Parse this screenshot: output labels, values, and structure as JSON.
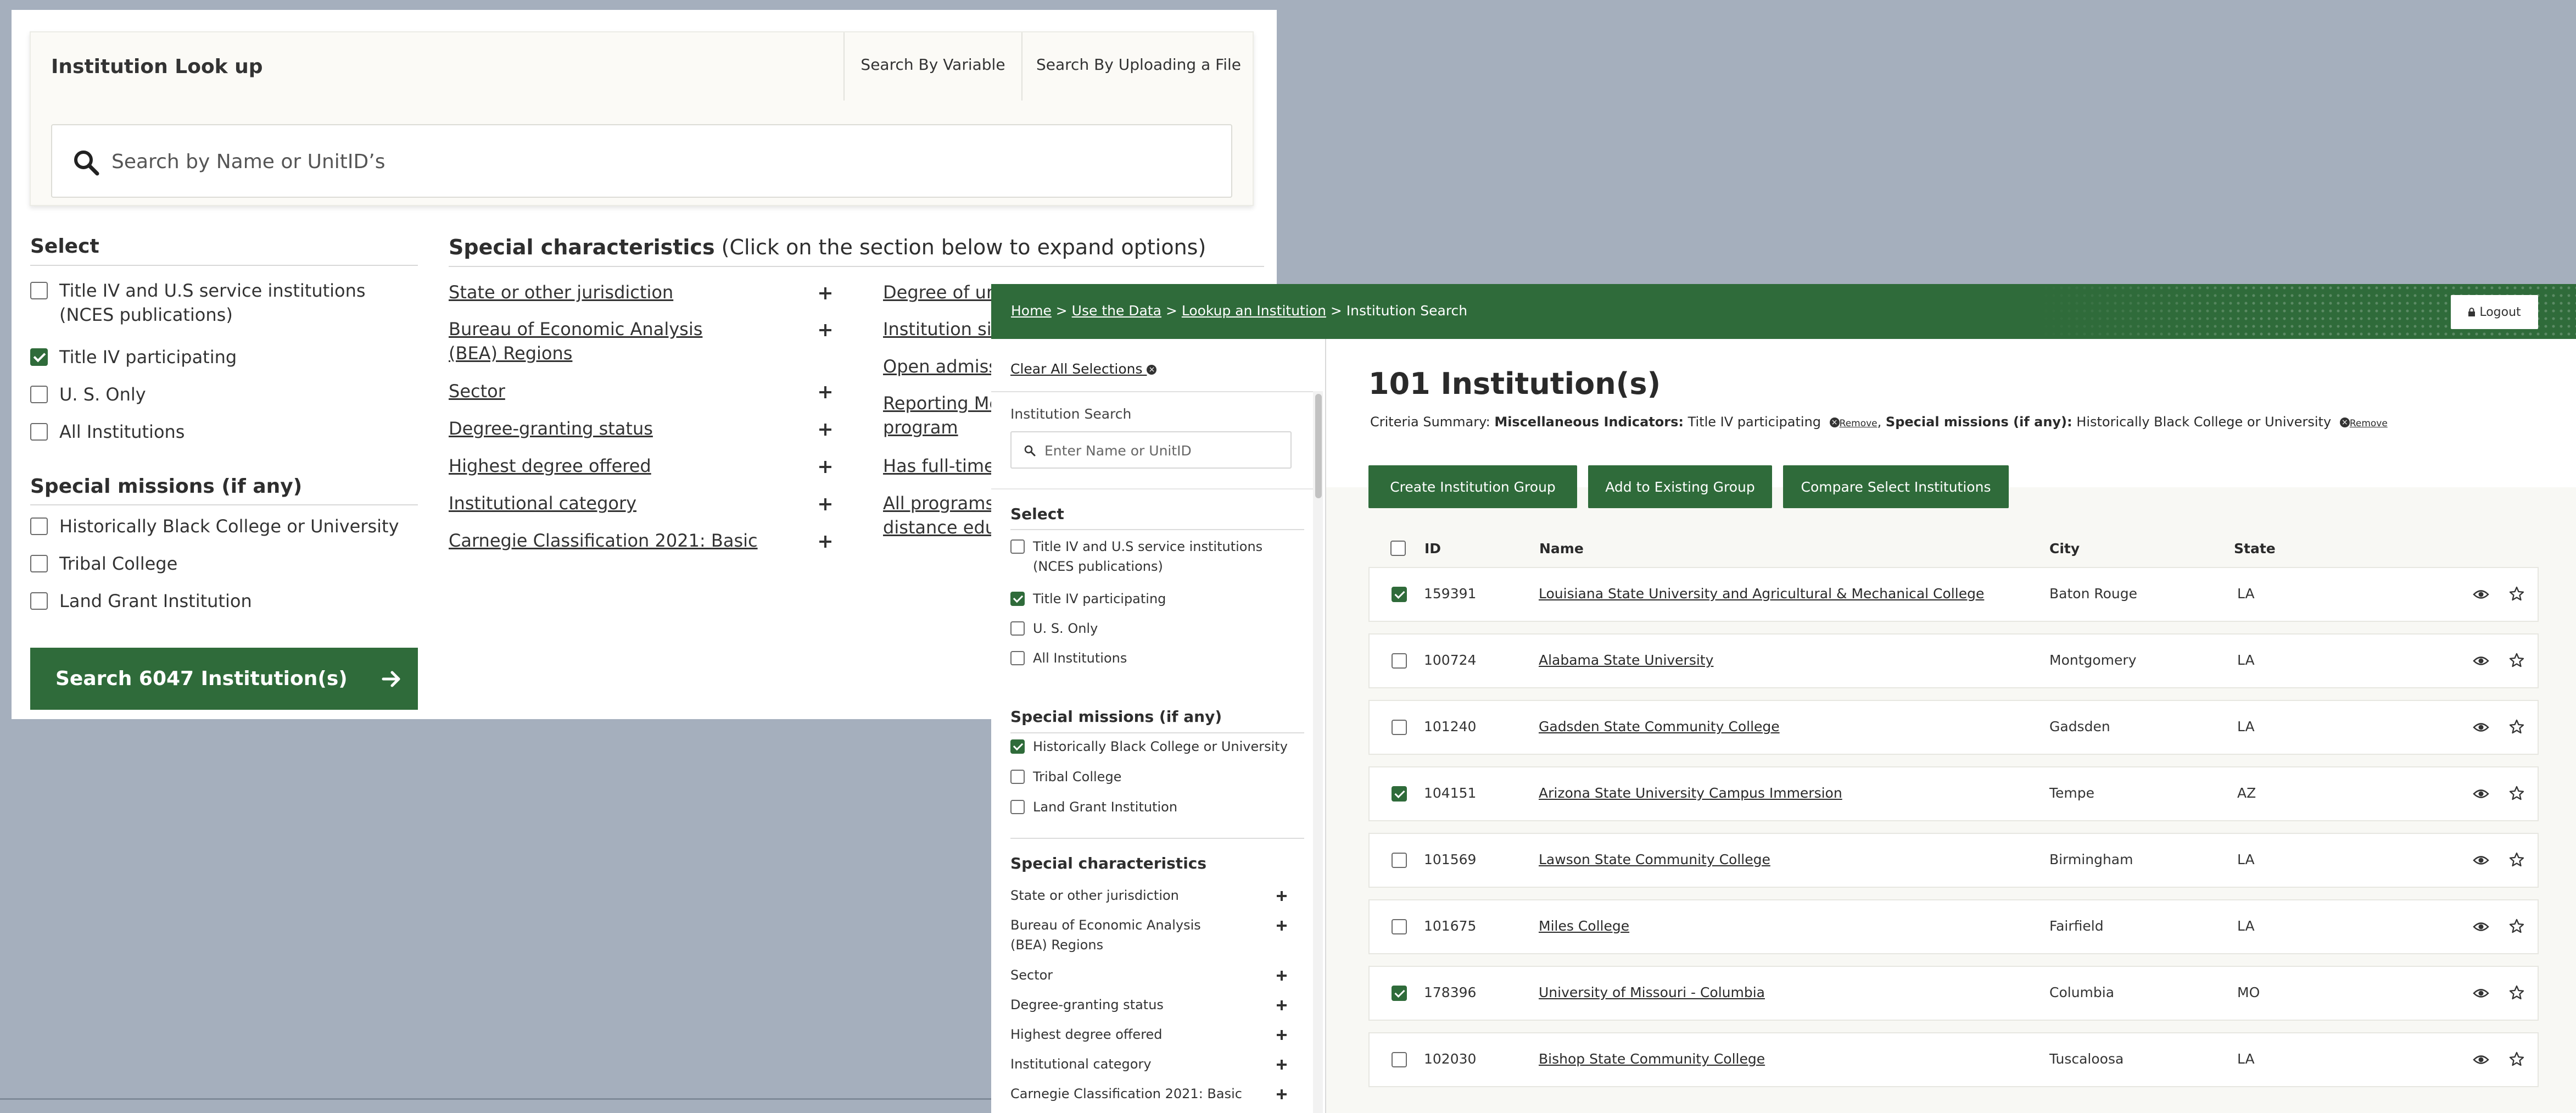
{
  "lookup": {
    "title": "Institution Look up",
    "links": [
      "Search By Variable",
      "Search By Uploading a File"
    ],
    "search_placeholder": "Search by Name or UnitID’s",
    "select_title": "Select",
    "select_items": [
      {
        "label": "Title IV and U.S service institutions (NCES publications)",
        "checked": false
      },
      {
        "label": "Title IV participating",
        "checked": true
      },
      {
        "label": "U. S. Only",
        "checked": false
      },
      {
        "label": "All Institutions",
        "checked": false
      }
    ],
    "missions_title": "Special missions (if any)",
    "mission_items": [
      {
        "label": "Historically Black College or University",
        "checked": false
      },
      {
        "label": "Tribal College",
        "checked": false
      },
      {
        "label": "Land Grant Institution",
        "checked": false
      }
    ],
    "search_button": "Search 6047 Institution(s)",
    "characteristics_title": "Special characteristics",
    "characteristics_hint": "(Click on the section below to expand options)",
    "characteristics_col1": [
      "State or other jurisdiction",
      "Bureau of Economic Analysis (BEA) Regions",
      "Sector",
      "Degree-granting status",
      "Highest degree offered",
      "Institutional category",
      "Carnegie Classification 2021: Basic"
    ],
    "characteristics_col2": [
      "Degree of urb",
      "Institution si",
      "Open admiss",
      "Reporting Me program",
      "Has full-time",
      "All programs distance edu"
    ]
  },
  "results": {
    "breadcrumb": [
      "Home",
      "Use the Data",
      "Lookup an Institution",
      "Institution Search"
    ],
    "logout": "Logout",
    "clear_all": "Clear All Selections",
    "sidebar_search_label": "Institution Search",
    "sidebar_search_placeholder": "Enter Name or UnitID",
    "select_title": "Select",
    "select_items": [
      {
        "label": "Title IV and U.S service institutions (NCES publications)",
        "checked": false
      },
      {
        "label": "Title IV participating",
        "checked": true
      },
      {
        "label": "U. S. Only",
        "checked": false
      },
      {
        "label": "All Institutions",
        "checked": false
      }
    ],
    "missions_title": "Special missions (if any)",
    "mission_items": [
      {
        "label": "Historically Black College or University",
        "checked": true
      },
      {
        "label": "Tribal College",
        "checked": false
      },
      {
        "label": "Land Grant Institution",
        "checked": false
      }
    ],
    "characteristics_title": "Special characteristics",
    "characteristics": [
      "State or other jurisdiction",
      "Bureau of Economic Analysis (BEA) Regions",
      "Sector",
      "Degree-granting status",
      "Highest degree offered",
      "Institutional category",
      "Carnegie Classification 2021: Basic"
    ],
    "count_title": "101 Institution(s)",
    "criteria": {
      "label": "Criteria Summary:",
      "k1": "Miscellaneous Indicators:",
      "v1": "Title IV participating",
      "remove": "Remove",
      "k2": "Special missions (if any):",
      "v2": "Historically Black College or University"
    },
    "buttons": [
      "Create Institution Group",
      "Add to Existing Group",
      "Compare Select Institutions"
    ],
    "columns": [
      "ID",
      "Name",
      "City",
      "State"
    ],
    "rows": [
      {
        "checked": true,
        "id": "159391",
        "name": "Louisiana State University and Agricultural & Mechanical College",
        "city": "Baton Rouge",
        "state": "LA"
      },
      {
        "checked": false,
        "id": "100724",
        "name": "Alabama State University",
        "city": "Montgomery",
        "state": "LA"
      },
      {
        "checked": false,
        "id": "101240",
        "name": "Gadsden State Community College",
        "city": "Gadsden",
        "state": "LA"
      },
      {
        "checked": true,
        "id": "104151",
        "name": "Arizona State University Campus Immersion",
        "city": "Tempe",
        "state": "AZ"
      },
      {
        "checked": false,
        "id": "101569",
        "name": "Lawson State Community College",
        "city": "Birmingham",
        "state": "LA"
      },
      {
        "checked": false,
        "id": "101675",
        "name": "Miles College",
        "city": "Fairfield",
        "state": "LA"
      },
      {
        "checked": true,
        "id": "178396",
        "name": "University of Missouri - Columbia",
        "city": "Columbia",
        "state": "MO"
      },
      {
        "checked": false,
        "id": "102030",
        "name": "Bishop State Community College",
        "city": "Tuscaloosa",
        "state": "LA"
      }
    ]
  },
  "colors": {
    "brand_green": "#2f6b3a",
    "background": "#a5afbd"
  },
  "icons": [
    "search-icon",
    "arrow-right-icon",
    "lock-icon",
    "remove-icon",
    "eye-icon",
    "star-icon",
    "plus-icon"
  ]
}
